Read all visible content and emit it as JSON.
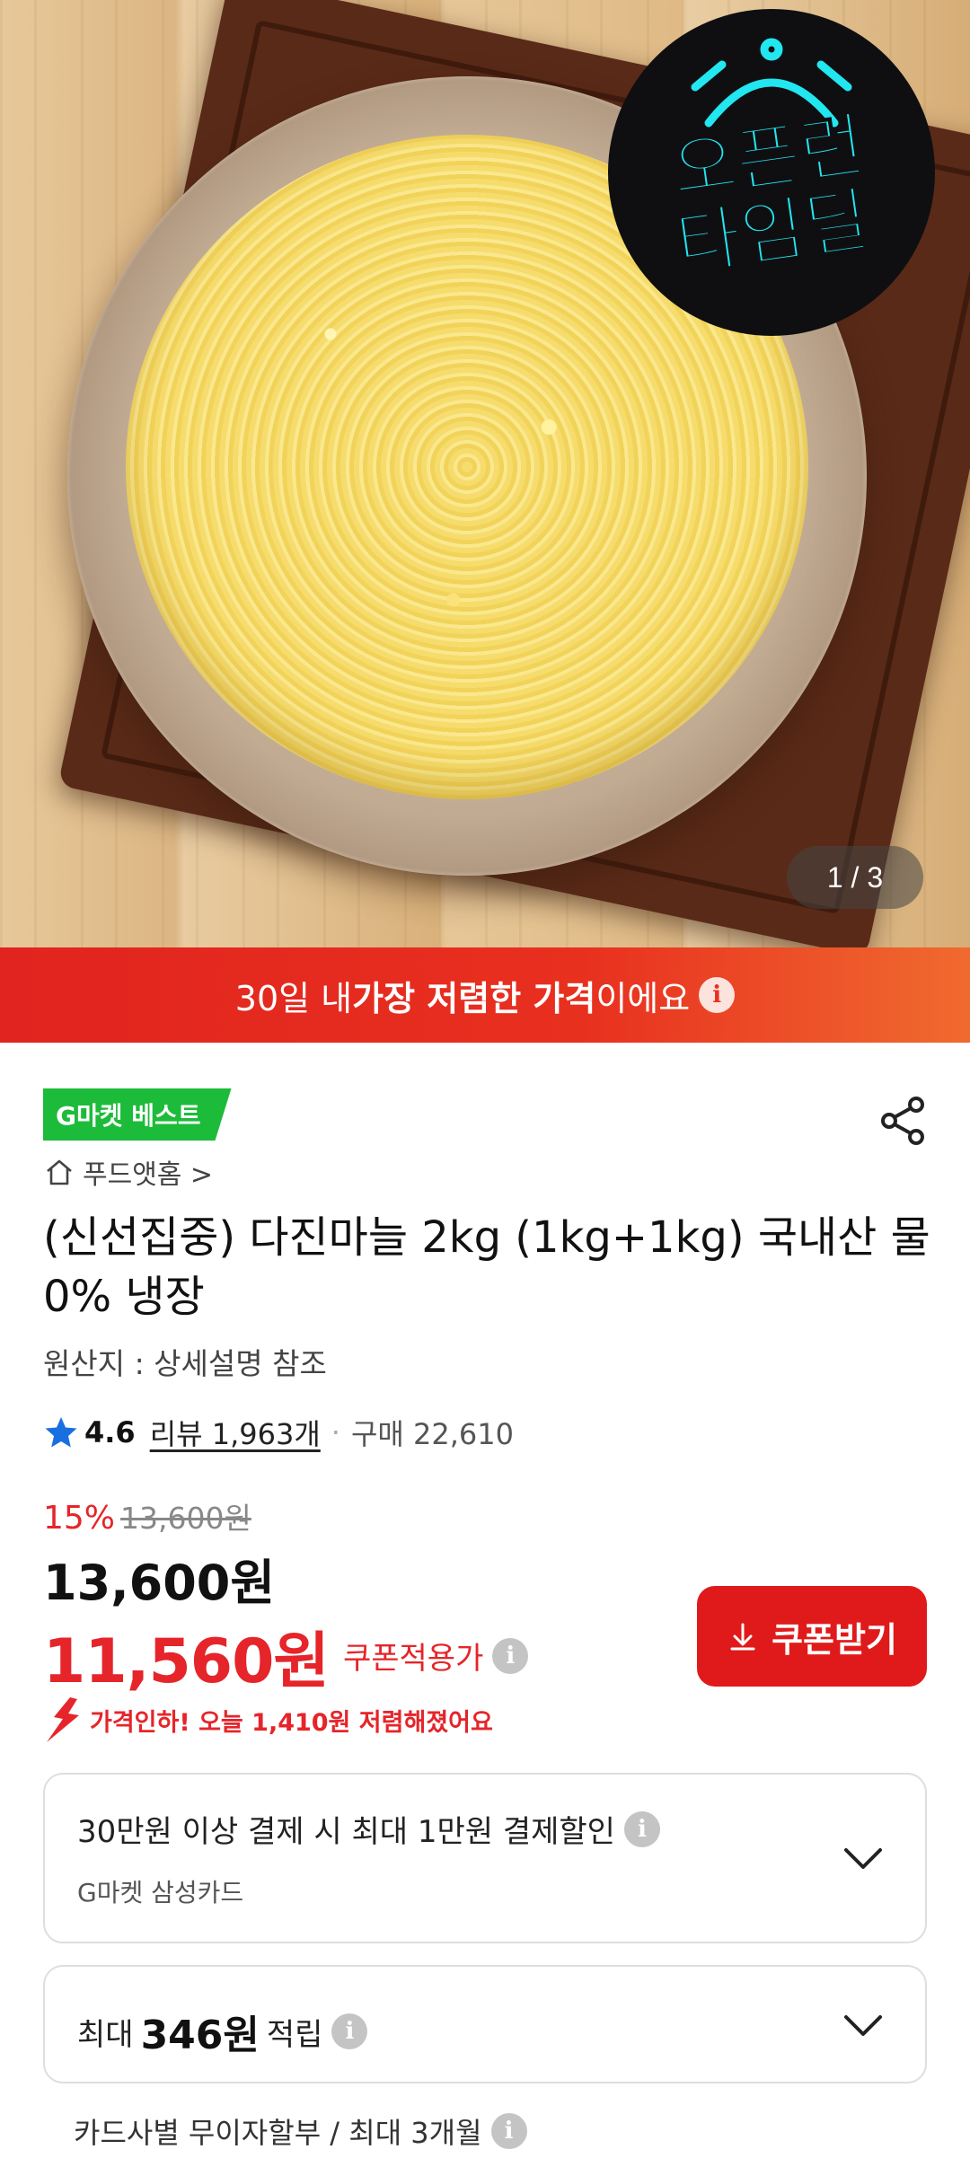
{
  "hero": {
    "badge_line1": "오픈런",
    "badge_line2": "타임딜",
    "image_counter": "1 / 3"
  },
  "banner": {
    "prefix": "30일 내 ",
    "highlight": "가장 저렴한 가격",
    "suffix": "이에요",
    "info_icon": "i"
  },
  "product": {
    "best_badge": "G마켓 베스트",
    "store_name": "푸드앳홈 >",
    "title": "(신선집중) 다진마늘 2kg (1kg+1kg) 국내산 물0% 냉장",
    "origin": "원산지 : 상세설명 참조",
    "rating": "4.6",
    "reviews": "리뷰 1,963개",
    "separator": "·",
    "purchases": "구매 22,610"
  },
  "price": {
    "discount_rate": "15%",
    "original_price": "13,600원",
    "sale_price": "13,600원",
    "coupon_price": "11,560원",
    "coupon_label": "쿠폰적용가",
    "coupon_button": "쿠폰받기",
    "price_drop": "가격인하! 오늘 1,410원 저렴해졌어요"
  },
  "benefits": {
    "card_discount": "30만원 이상 결제 시 최대 1만원 결제할인",
    "card_name": "G마켓 삼성카드",
    "points_prefix": "최대",
    "points_value": "346원",
    "points_suffix": "적립",
    "installment": "카드사별 무이자할부 / 최대 3개월"
  },
  "colors": {
    "accent_red": "#e5252a",
    "banner_start": "#e1241f",
    "banner_end": "#f06a2f",
    "best_green": "#1dbb3a",
    "neon_cyan": "#22e6f0"
  }
}
